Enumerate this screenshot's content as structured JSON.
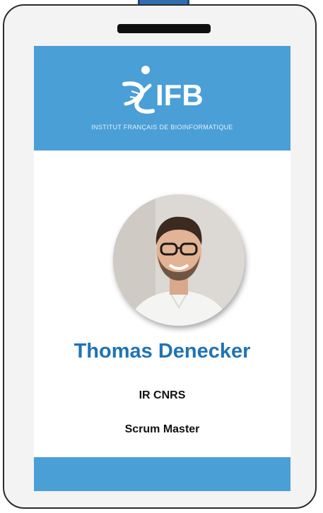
{
  "badge": {
    "logo_text": "IFB",
    "logo_subtitle": "INSTITUT FRANÇAIS DE BIOINFORMATIQUE",
    "name": "Thomas Denecker",
    "organization": "IR CNRS",
    "role": "Scrum Master"
  },
  "colors": {
    "brand_blue": "#4a9fd6",
    "name_blue": "#1f73b6",
    "lanyard": "#2f6fb0"
  }
}
